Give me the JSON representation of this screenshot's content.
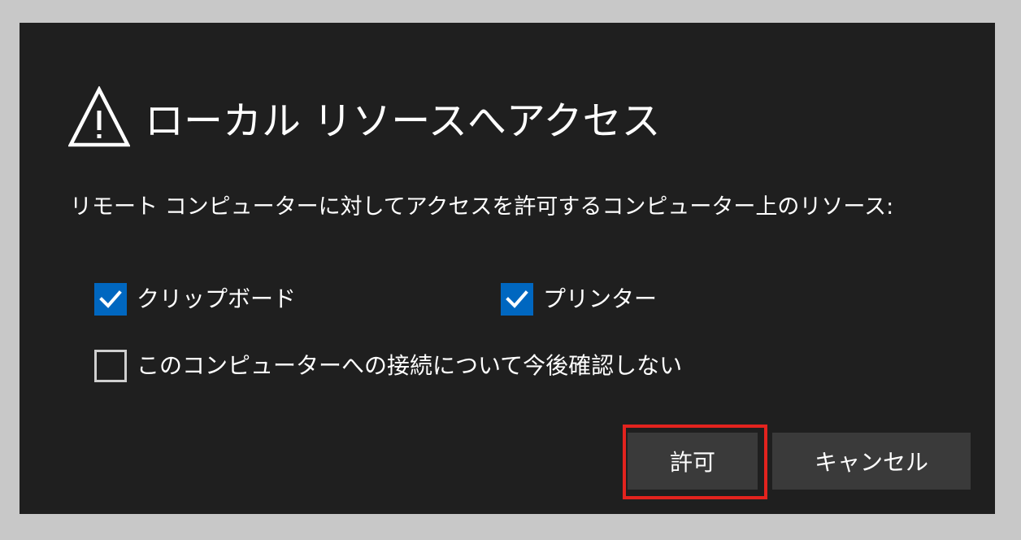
{
  "dialog": {
    "title": "ローカル リソースへアクセス",
    "icon": "warning-triangle-icon",
    "description": "リモート コンピューターに対してアクセスを許可するコンピューター上のリソース:",
    "options": {
      "clipboard": {
        "label": "クリップボード",
        "checked": true
      },
      "printer": {
        "label": "プリンター",
        "checked": true
      },
      "dont_ask": {
        "label": "このコンピューターへの接続について今後確認しない",
        "checked": false
      }
    },
    "buttons": {
      "allow_label": "許可",
      "cancel_label": "キャンセル"
    }
  },
  "colors": {
    "background": "#c8c8c8",
    "dialog_bg": "#1f1f1f",
    "checkbox_checked": "#0067c0",
    "button_bg": "#3a3a3a",
    "highlight": "#e3231e",
    "text": "#ffffff"
  }
}
